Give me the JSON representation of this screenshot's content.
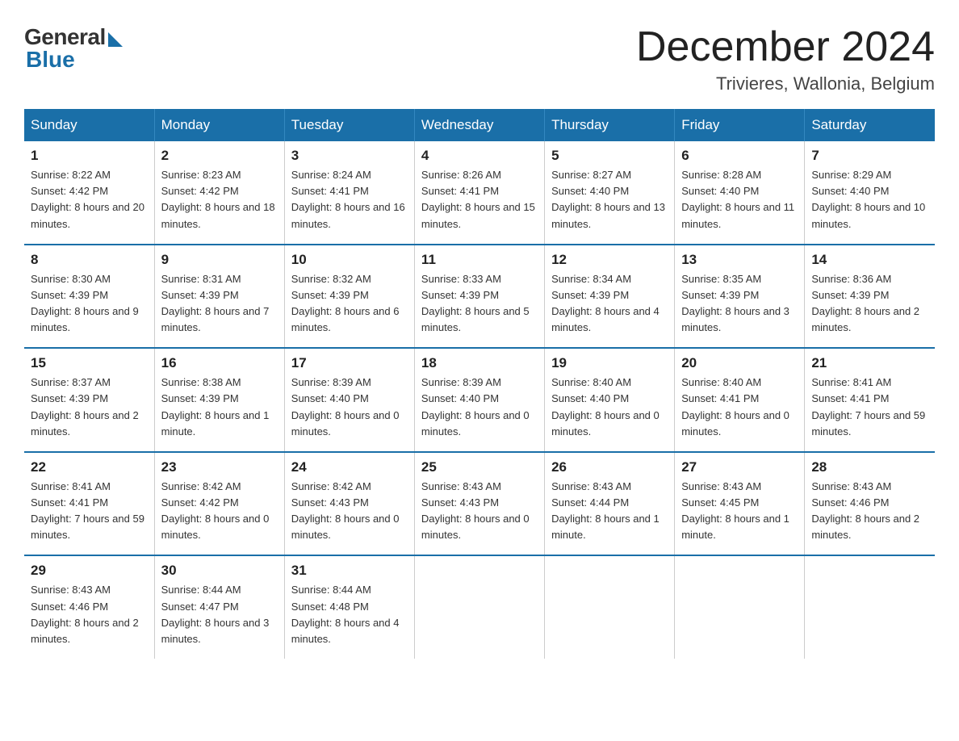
{
  "logo": {
    "general": "General",
    "blue": "Blue"
  },
  "title": "December 2024",
  "location": "Trivieres, Wallonia, Belgium",
  "days_of_week": [
    "Sunday",
    "Monday",
    "Tuesday",
    "Wednesday",
    "Thursday",
    "Friday",
    "Saturday"
  ],
  "weeks": [
    [
      {
        "day": "1",
        "sunrise": "8:22 AM",
        "sunset": "4:42 PM",
        "daylight": "8 hours and 20 minutes."
      },
      {
        "day": "2",
        "sunrise": "8:23 AM",
        "sunset": "4:42 PM",
        "daylight": "8 hours and 18 minutes."
      },
      {
        "day": "3",
        "sunrise": "8:24 AM",
        "sunset": "4:41 PM",
        "daylight": "8 hours and 16 minutes."
      },
      {
        "day": "4",
        "sunrise": "8:26 AM",
        "sunset": "4:41 PM",
        "daylight": "8 hours and 15 minutes."
      },
      {
        "day": "5",
        "sunrise": "8:27 AM",
        "sunset": "4:40 PM",
        "daylight": "8 hours and 13 minutes."
      },
      {
        "day": "6",
        "sunrise": "8:28 AM",
        "sunset": "4:40 PM",
        "daylight": "8 hours and 11 minutes."
      },
      {
        "day": "7",
        "sunrise": "8:29 AM",
        "sunset": "4:40 PM",
        "daylight": "8 hours and 10 minutes."
      }
    ],
    [
      {
        "day": "8",
        "sunrise": "8:30 AM",
        "sunset": "4:39 PM",
        "daylight": "8 hours and 9 minutes."
      },
      {
        "day": "9",
        "sunrise": "8:31 AM",
        "sunset": "4:39 PM",
        "daylight": "8 hours and 7 minutes."
      },
      {
        "day": "10",
        "sunrise": "8:32 AM",
        "sunset": "4:39 PM",
        "daylight": "8 hours and 6 minutes."
      },
      {
        "day": "11",
        "sunrise": "8:33 AM",
        "sunset": "4:39 PM",
        "daylight": "8 hours and 5 minutes."
      },
      {
        "day": "12",
        "sunrise": "8:34 AM",
        "sunset": "4:39 PM",
        "daylight": "8 hours and 4 minutes."
      },
      {
        "day": "13",
        "sunrise": "8:35 AM",
        "sunset": "4:39 PM",
        "daylight": "8 hours and 3 minutes."
      },
      {
        "day": "14",
        "sunrise": "8:36 AM",
        "sunset": "4:39 PM",
        "daylight": "8 hours and 2 minutes."
      }
    ],
    [
      {
        "day": "15",
        "sunrise": "8:37 AM",
        "sunset": "4:39 PM",
        "daylight": "8 hours and 2 minutes."
      },
      {
        "day": "16",
        "sunrise": "8:38 AM",
        "sunset": "4:39 PM",
        "daylight": "8 hours and 1 minute."
      },
      {
        "day": "17",
        "sunrise": "8:39 AM",
        "sunset": "4:40 PM",
        "daylight": "8 hours and 0 minutes."
      },
      {
        "day": "18",
        "sunrise": "8:39 AM",
        "sunset": "4:40 PM",
        "daylight": "8 hours and 0 minutes."
      },
      {
        "day": "19",
        "sunrise": "8:40 AM",
        "sunset": "4:40 PM",
        "daylight": "8 hours and 0 minutes."
      },
      {
        "day": "20",
        "sunrise": "8:40 AM",
        "sunset": "4:41 PM",
        "daylight": "8 hours and 0 minutes."
      },
      {
        "day": "21",
        "sunrise": "8:41 AM",
        "sunset": "4:41 PM",
        "daylight": "7 hours and 59 minutes."
      }
    ],
    [
      {
        "day": "22",
        "sunrise": "8:41 AM",
        "sunset": "4:41 PM",
        "daylight": "7 hours and 59 minutes."
      },
      {
        "day": "23",
        "sunrise": "8:42 AM",
        "sunset": "4:42 PM",
        "daylight": "8 hours and 0 minutes."
      },
      {
        "day": "24",
        "sunrise": "8:42 AM",
        "sunset": "4:43 PM",
        "daylight": "8 hours and 0 minutes."
      },
      {
        "day": "25",
        "sunrise": "8:43 AM",
        "sunset": "4:43 PM",
        "daylight": "8 hours and 0 minutes."
      },
      {
        "day": "26",
        "sunrise": "8:43 AM",
        "sunset": "4:44 PM",
        "daylight": "8 hours and 1 minute."
      },
      {
        "day": "27",
        "sunrise": "8:43 AM",
        "sunset": "4:45 PM",
        "daylight": "8 hours and 1 minute."
      },
      {
        "day": "28",
        "sunrise": "8:43 AM",
        "sunset": "4:46 PM",
        "daylight": "8 hours and 2 minutes."
      }
    ],
    [
      {
        "day": "29",
        "sunrise": "8:43 AM",
        "sunset": "4:46 PM",
        "daylight": "8 hours and 2 minutes."
      },
      {
        "day": "30",
        "sunrise": "8:44 AM",
        "sunset": "4:47 PM",
        "daylight": "8 hours and 3 minutes."
      },
      {
        "day": "31",
        "sunrise": "8:44 AM",
        "sunset": "4:48 PM",
        "daylight": "8 hours and 4 minutes."
      },
      null,
      null,
      null,
      null
    ]
  ]
}
